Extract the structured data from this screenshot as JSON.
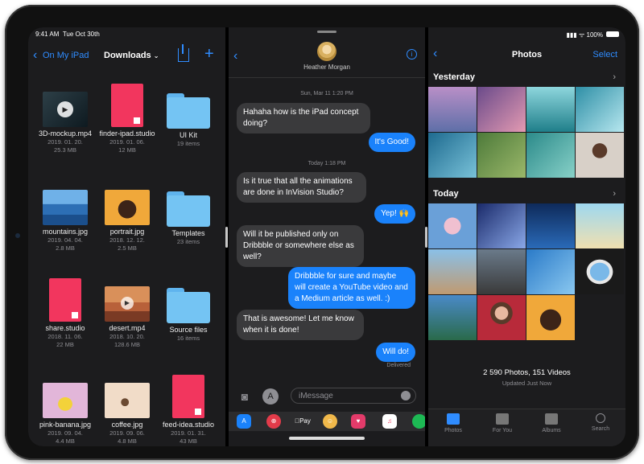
{
  "files": {
    "status_time": "9:41 AM",
    "status_date": "Tue Oct 30th",
    "back_label": "On My iPad",
    "title": "Downloads",
    "items": [
      {
        "name": "3D-mockup.mp4",
        "date": "2019. 01. 20.",
        "size": "25.3 MB"
      },
      {
        "name": "finder-ipad.studio",
        "date": "2019. 01. 06.",
        "size": "12 MB"
      },
      {
        "name": "UI Kit",
        "count": "19 items"
      },
      {
        "name": "mountains.jpg",
        "date": "2019. 04. 04.",
        "size": "2.8 MB"
      },
      {
        "name": "portrait.jpg",
        "date": "2018. 12. 12.",
        "size": "2.5 MB"
      },
      {
        "name": "Templates",
        "count": "23 items"
      },
      {
        "name": "share.studio",
        "date": "2018. 11. 06.",
        "size": "22 MB"
      },
      {
        "name": "desert.mp4",
        "date": "2018. 10. 20.",
        "size": "128.6 MB"
      },
      {
        "name": "Source files",
        "count": "16 items"
      },
      {
        "name": "pink-banana.jpg",
        "date": "2019. 09. 04.",
        "size": "4.4 MB"
      },
      {
        "name": "coffee.jpg",
        "date": "2019. 09. 06.",
        "size": "4.8 MB"
      },
      {
        "name": "feed-idea.studio",
        "date": "2019. 01. 31.",
        "size": "43 MB"
      }
    ]
  },
  "messages": {
    "contact_name": "Heather Morgan",
    "stamp1": "Sun, Mar 11 1:20 PM",
    "stamp2": "Today 1:18 PM",
    "bubbles": [
      "Hahaha how is the iPad concept doing?",
      "It's Good!",
      "Is it true that all the animations are done in InVision Studio?",
      "Yep! 🙌",
      "Will it be published only on Dribbble or somewhere else as well?",
      "Dribbble for sure and maybe will create a YouTube video and a Medium article as well. :)",
      "That is awesome! Let me know when it is done!",
      "Will do!"
    ],
    "delivered": "Delivered",
    "input_placeholder": "iMessage",
    "apple_pay": "Pay"
  },
  "photos": {
    "battery": "100%",
    "title": "Photos",
    "select": "Select",
    "yesterday": "Yesterday",
    "today": "Today",
    "count": "2 590 Photos, 151 Videos",
    "updated": "Updated Just Now",
    "tabs": [
      "Photos",
      "For You",
      "Albums",
      "Search"
    ],
    "accent": "#2f8cff"
  }
}
